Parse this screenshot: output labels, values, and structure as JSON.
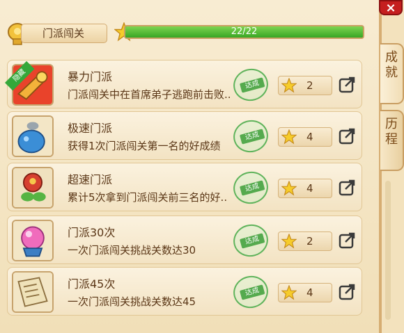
{
  "header": {
    "title": "门派闯关",
    "progress_text": "22/22",
    "progress_fraction": 1.0
  },
  "close_label": "×",
  "side_tabs": [
    {
      "label": "成就"
    },
    {
      "label": "历程"
    }
  ],
  "rows": [
    {
      "title": "暴力门派",
      "desc": "门派闯关中在首席弟子逃跑前击败..",
      "stamp": "达成",
      "reward": "2",
      "ribbon": "隐藏",
      "icon": "horn-icon"
    },
    {
      "title": "极速门派",
      "desc": "获得1次门派闯关第一名的好成绩",
      "stamp": "达成",
      "reward": "4",
      "icon": "potion-bag-icon"
    },
    {
      "title": "超速门派",
      "desc": "累计5次拿到门派闯关前三名的好..",
      "stamp": "达成",
      "reward": "4",
      "icon": "treasure-icon"
    },
    {
      "title": "门派30次",
      "desc": "一次门派闯关挑战关数达30",
      "stamp": "达成",
      "reward": "2",
      "icon": "crystal-orb-icon"
    },
    {
      "title": "门派45次",
      "desc": "一次门派闯关挑战关数达45",
      "stamp": "达成",
      "reward": "4",
      "icon": "scroll-book-icon"
    }
  ],
  "colors": {
    "progress_green": "#4cbc34",
    "stamp_green": "#3b9638",
    "close_red": "#c51f1f",
    "text_brown": "#5a3616"
  }
}
